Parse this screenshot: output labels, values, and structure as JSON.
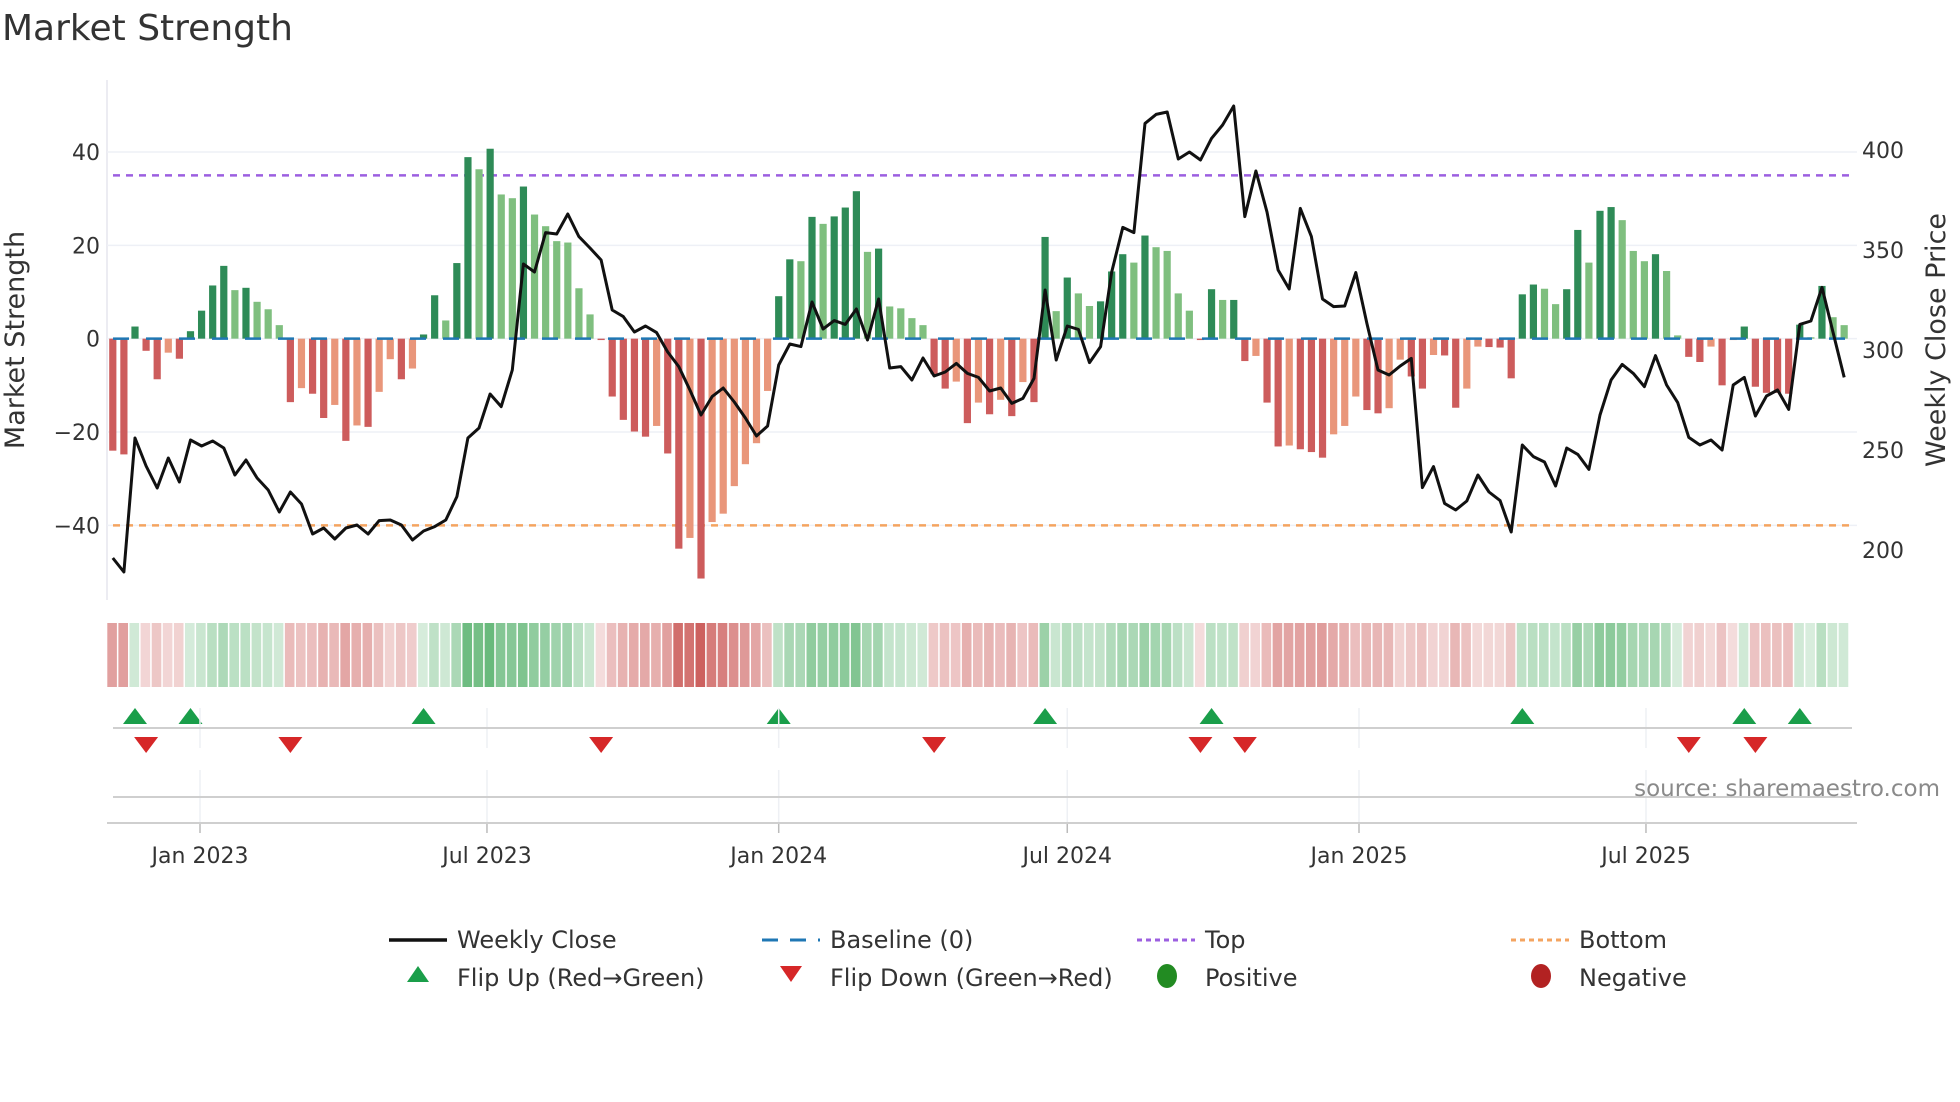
{
  "chart_data": {
    "type": "bar",
    "title": "Market Strength",
    "ylabel": "Market Strength",
    "ylabel_right": "Weekly Close Price",
    "ylim": [
      -56,
      55
    ],
    "ylim_right": [
      175,
      434
    ],
    "yticks": [
      40,
      20,
      0,
      -20,
      -40
    ],
    "yticks_right": [
      400,
      350,
      300,
      250,
      200
    ],
    "xtick_labels": [
      {
        "date": "2023-01-01",
        "label": "Jan 2023"
      },
      {
        "date": "2023-07-01",
        "label": "Jul 2023"
      },
      {
        "date": "2024-01-01",
        "label": "Jan 2024"
      },
      {
        "date": "2024-07-01",
        "label": "Jul 2024"
      },
      {
        "date": "2025-01-01",
        "label": "Jan 2025"
      },
      {
        "date": "2025-07-01",
        "label": "Jul 2025"
      }
    ],
    "start_date": "2022-11-07",
    "frequency": "weekly",
    "top_level": 35,
    "bottom_level": -40,
    "baseline": 0,
    "strength": [
      -24,
      -24.8,
      2.6,
      -2.6,
      -8.7,
      -3,
      -4.3,
      1.6,
      6,
      11.4,
      15.6,
      10.4,
      10.9,
      7.9,
      6.3,
      2.9,
      -13.6,
      -10.6,
      -11.8,
      -17,
      -14.2,
      -21.9,
      -18.6,
      -18.9,
      -11.4,
      -4.4,
      -8.7,
      -6.4,
      0.9,
      9.3,
      3.9,
      16.2,
      38.9,
      36.3,
      40.7,
      30.9,
      30.1,
      32.6,
      26.6,
      24.1,
      20.9,
      20.6,
      10.8,
      5.2,
      -0.3,
      -12.4,
      -17.4,
      -19.9,
      -21,
      -18.7,
      -24.6,
      -45,
      -42.7,
      -51.4,
      -39.3,
      -37.5,
      -31.6,
      -26.9,
      -22.4,
      -11.2,
      9.1,
      17,
      16.6,
      26.1,
      24.6,
      26.2,
      28.1,
      31.6,
      18.6,
      19.3,
      6.9,
      6.5,
      4.4,
      2.9,
      -7.6,
      -10.7,
      -9.2,
      -18.1,
      -13.7,
      -16.2,
      -13.1,
      -16.6,
      -9.3,
      -13.6,
      21.8,
      5.9,
      13.1,
      9.7,
      7.0,
      8.0,
      14.4,
      18.1,
      16.3,
      22.1,
      19.6,
      18.8,
      9.7,
      6.0,
      -0.3,
      10.6,
      8.3,
      8.3,
      -4.8,
      -3.7,
      -13.7,
      -23.1,
      -22.9,
      -23.7,
      -24.3,
      -25.5,
      -20.5,
      -18.7,
      -12.4,
      -15.3,
      -16,
      -14.9,
      -4.5,
      -8.1,
      -10.7,
      -3.5,
      -3.6,
      -14.8,
      -10.7,
      -1.7,
      -1.8,
      -1.9,
      -8.5,
      9.5,
      11.6,
      10.7,
      7.4,
      10.6,
      23.3,
      16.3,
      27.4,
      28.2,
      25.4,
      18.8,
      16.6,
      18.1,
      14.5,
      0.7,
      -3.9,
      -5,
      -1.7,
      -10,
      -0.3,
      2.6,
      -10.3,
      -11.6,
      -11.6,
      -11.8,
      3,
      0.3,
      11.3,
      4.6,
      2.9
    ],
    "weekly_close": [
      196,
      189,
      256,
      242,
      231,
      246,
      234,
      255,
      252,
      254.5,
      251,
      237.5,
      245,
      236,
      230,
      219,
      229,
      223,
      208,
      211,
      205.5,
      211,
      212.5,
      208,
      214.7,
      215,
      212.5,
      205,
      209.5,
      211.7,
      215,
      226.7,
      256,
      261,
      278,
      271.7,
      290,
      343,
      339,
      358.7,
      358,
      368,
      356.7,
      351,
      345,
      320,
      316.7,
      309,
      312,
      308.7,
      299,
      291.7,
      280,
      267.5,
      276.7,
      281,
      274,
      266,
      257,
      262,
      292.5,
      303,
      301.7,
      324,
      310.5,
      314.7,
      312.8,
      320.5,
      305,
      325.5,
      291,
      291.7,
      285,
      296,
      287,
      289,
      293.3,
      288.3,
      286.3,
      279.5,
      281,
      273.3,
      275.8,
      285.8,
      330,
      295,
      312,
      310.3,
      293.7,
      301.7,
      339,
      361.3,
      358.7,
      413.3,
      417.8,
      419,
      395.5,
      399,
      395,
      405.8,
      412.5,
      422,
      366.7,
      389.5,
      369,
      340,
      330.5,
      370.8,
      356.7,
      325.5,
      321.7,
      322,
      338.7,
      313.3,
      290,
      287.5,
      292,
      295.8,
      231.2,
      241.7,
      223.3,
      220,
      224.5,
      237.5,
      229,
      224.7,
      209,
      252.5,
      246.7,
      244,
      232,
      251,
      247.8,
      240.3,
      267.5,
      285,
      292.8,
      288.3,
      281.7,
      297.2,
      282.5,
      273.7,
      256.3,
      252.5,
      255,
      250,
      282.5,
      286.3,
      267,
      277,
      280,
      270.3,
      312.8,
      314.5,
      331.3,
      308.7,
      286.3
    ],
    "flip_up_weeks": [
      3,
      8,
      29,
      61,
      85,
      100,
      128,
      148,
      153
    ],
    "flip_down_weeks": [
      4,
      17,
      45,
      75,
      99,
      103,
      143,
      149
    ],
    "colors": {
      "up_strong": "#2e8b57",
      "up_weak": "#7fbf7f",
      "down_strong": "#cd5c5c",
      "down_weak": "#e9967a",
      "close_line": "#111111",
      "baseline": "#1f77b4",
      "top": "#9c5fe0",
      "bottom": "#f4a460",
      "flip_up": "#1a9e4a",
      "flip_down": "#d62728",
      "positive": "#228b22",
      "negative": "#b22222"
    },
    "legend": {
      "placement": "bottom",
      "items": [
        {
          "key": "close",
          "label": "Weekly Close"
        },
        {
          "key": "baseline",
          "label": "Baseline (0)"
        },
        {
          "key": "top",
          "label": "Top"
        },
        {
          "key": "bottom",
          "label": "Bottom"
        },
        {
          "key": "flip_up",
          "label": "Flip Up (Red→Green)"
        },
        {
          "key": "flip_down",
          "label": "Flip Down (Green→Red)"
        },
        {
          "key": "positive",
          "label": "Positive"
        },
        {
          "key": "negative",
          "label": "Negative"
        }
      ]
    },
    "source": "source: sharemaestro.com"
  }
}
